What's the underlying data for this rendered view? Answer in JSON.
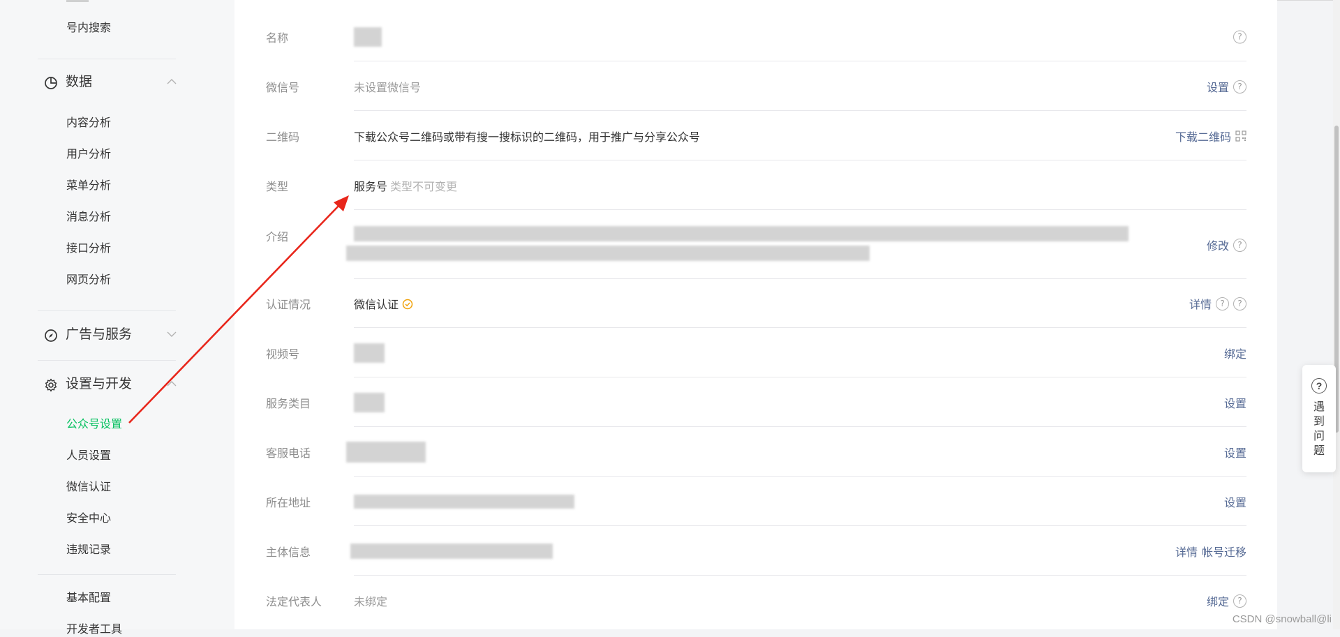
{
  "sidebar": {
    "items_top": [
      "号内搜索"
    ],
    "groups": {
      "data": {
        "label": "数据",
        "icon": "pie-chart-icon"
      },
      "ads": {
        "label": "广告与服务",
        "icon": "compass-icon"
      },
      "settings": {
        "label": "设置与开发",
        "icon": "gear-icon"
      }
    },
    "data_items": [
      "内容分析",
      "用户分析",
      "菜单分析",
      "消息分析",
      "接口分析",
      "网页分析"
    ],
    "settings_items": [
      "公众号设置",
      "人员设置",
      "微信认证",
      "安全中心",
      "违规记录"
    ],
    "bottom_items": [
      "基本配置",
      "开发者工具"
    ],
    "active_item": "公众号设置"
  },
  "settings_table": {
    "rows": [
      {
        "label": "名称",
        "value": "",
        "actions": []
      },
      {
        "label": "微信号",
        "value": "未设置微信号",
        "actions": [
          "设置"
        ]
      },
      {
        "label": "二维码",
        "value": "下载公众号二维码或带有搜一搜标识的二维码，用于推广与分享公众号",
        "actions": [
          "下载二维码"
        ]
      },
      {
        "label": "类型",
        "value": "服务号",
        "value_note": "类型不可变更",
        "actions": []
      },
      {
        "label": "介绍",
        "value": "",
        "actions": [
          "修改"
        ]
      },
      {
        "label": "认证情况",
        "value": "微信认证",
        "actions": [
          "详情"
        ]
      },
      {
        "label": "视频号",
        "value": "",
        "actions": [
          "绑定"
        ]
      },
      {
        "label": "服务类目",
        "value": "",
        "actions": [
          "设置"
        ]
      },
      {
        "label": "客服电话",
        "value": "",
        "actions": [
          "设置"
        ]
      },
      {
        "label": "所在地址",
        "value": "",
        "actions": [
          "设置"
        ]
      },
      {
        "label": "主体信息",
        "value": "",
        "actions": [
          "详情",
          "帐号迁移"
        ]
      },
      {
        "label": "法定代表人",
        "value": "未绑定",
        "actions": [
          "绑定"
        ]
      }
    ]
  },
  "help_float": {
    "icon": "question-icon",
    "text": "遇到问题"
  },
  "colors": {
    "accent_green": "#07c160",
    "link_blue": "#576b95",
    "annotation_red": "#e8261b"
  },
  "watermark": "CSDN @snowball@li"
}
